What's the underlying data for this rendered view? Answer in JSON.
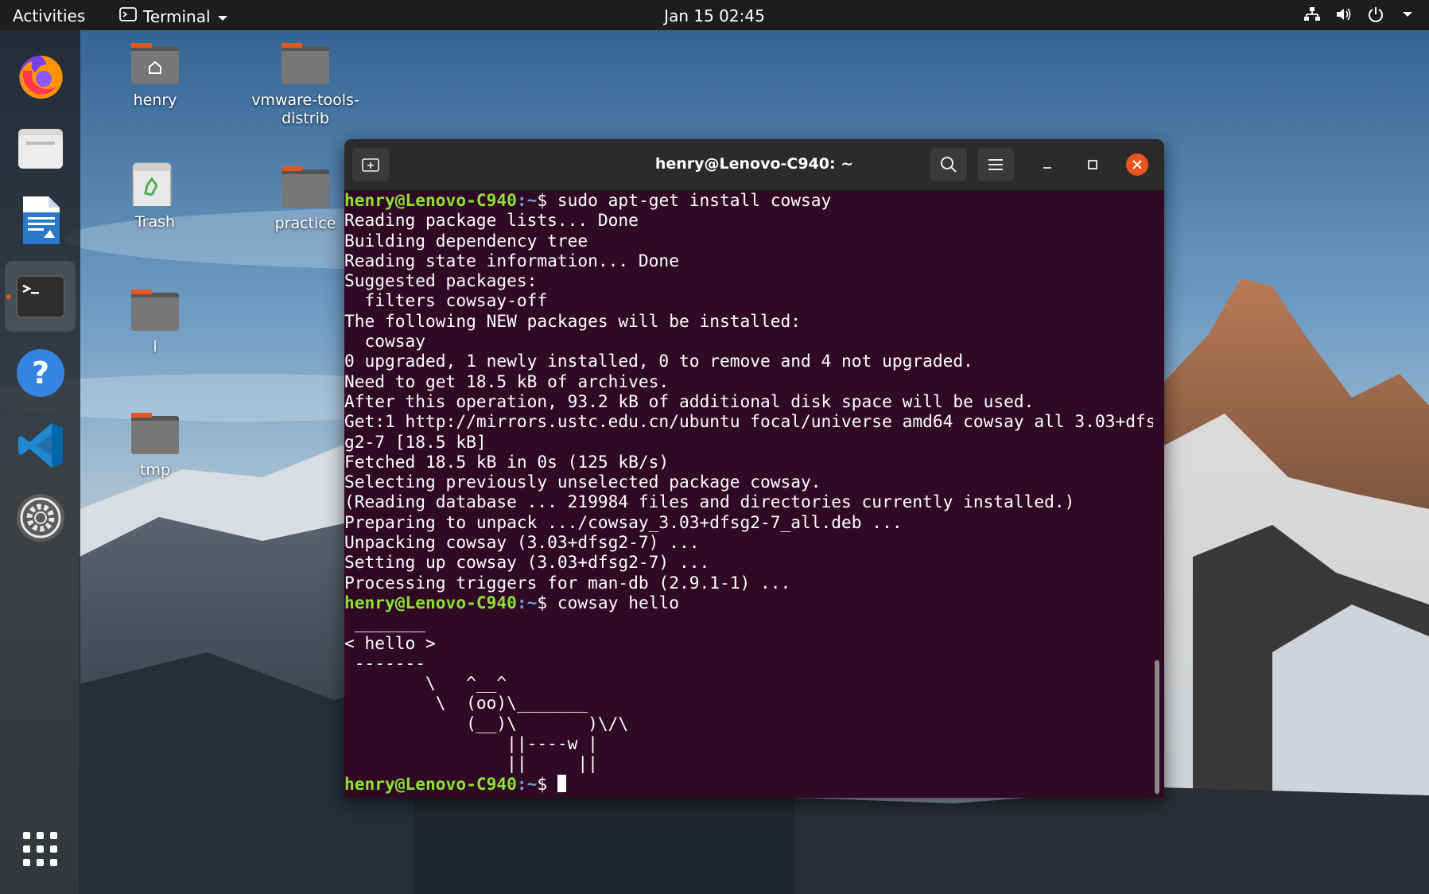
{
  "topbar": {
    "activities": "Activities",
    "app_name": "Terminal",
    "clock": "Jan 15  02:45"
  },
  "dock": {
    "items": [
      {
        "name": "Firefox"
      },
      {
        "name": "Files"
      },
      {
        "name": "LibreOffice Writer"
      },
      {
        "name": "Terminal"
      },
      {
        "name": "Help"
      },
      {
        "name": "Visual Studio Code"
      },
      {
        "name": "Settings"
      },
      {
        "name": "Show Applications"
      }
    ]
  },
  "desktop": {
    "icons": [
      {
        "label": "henry"
      },
      {
        "label": "vmware-tools-\ndistrib"
      },
      {
        "label": "Trash"
      },
      {
        "label": "practice"
      },
      {
        "label": "l"
      },
      {
        "label": "tmp"
      }
    ]
  },
  "terminal": {
    "title": "henry@Lenovo-C940: ~",
    "prompt_user": "henry@Lenovo-C940",
    "prompt_path": ":~",
    "prompt_symbol": "$",
    "lines": [
      {
        "type": "cmd",
        "text": " sudo apt-get install cowsay"
      },
      {
        "type": "out",
        "text": "Reading package lists... Done"
      },
      {
        "type": "out",
        "text": "Building dependency tree"
      },
      {
        "type": "out",
        "text": "Reading state information... Done"
      },
      {
        "type": "out",
        "text": "Suggested packages:"
      },
      {
        "type": "out",
        "text": "  filters cowsay-off"
      },
      {
        "type": "out",
        "text": "The following NEW packages will be installed:"
      },
      {
        "type": "out",
        "text": "  cowsay"
      },
      {
        "type": "out",
        "text": "0 upgraded, 1 newly installed, 0 to remove and 4 not upgraded."
      },
      {
        "type": "out",
        "text": "Need to get 18.5 kB of archives."
      },
      {
        "type": "out",
        "text": "After this operation, 93.2 kB of additional disk space will be used."
      },
      {
        "type": "out",
        "text": "Get:1 http://mirrors.ustc.edu.cn/ubuntu focal/universe amd64 cowsay all 3.03+dfs"
      },
      {
        "type": "out",
        "text": "g2-7 [18.5 kB]"
      },
      {
        "type": "out",
        "text": "Fetched 18.5 kB in 0s (125 kB/s)"
      },
      {
        "type": "out",
        "text": "Selecting previously unselected package cowsay."
      },
      {
        "type": "out",
        "text": "(Reading database ... 219984 files and directories currently installed.)"
      },
      {
        "type": "out",
        "text": "Preparing to unpack .../cowsay_3.03+dfsg2-7_all.deb ..."
      },
      {
        "type": "out",
        "text": "Unpacking cowsay (3.03+dfsg2-7) ..."
      },
      {
        "type": "out",
        "text": "Setting up cowsay (3.03+dfsg2-7) ..."
      },
      {
        "type": "out",
        "text": "Processing triggers for man-db (2.9.1-1) ..."
      },
      {
        "type": "cmd",
        "text": " cowsay hello"
      },
      {
        "type": "out",
        "text": " _______"
      },
      {
        "type": "out",
        "text": "< hello >"
      },
      {
        "type": "out",
        "text": " -------"
      },
      {
        "type": "out",
        "text": "        \\   ^__^"
      },
      {
        "type": "out",
        "text": "         \\  (oo)\\_______"
      },
      {
        "type": "out",
        "text": "            (__)\\       )\\/\\"
      },
      {
        "type": "out",
        "text": "                ||----w |"
      },
      {
        "type": "out",
        "text": "                ||     ||"
      },
      {
        "type": "prompt",
        "text": " "
      }
    ]
  },
  "colors": {
    "terminal_bg": "#300a24",
    "prompt_user": "#8ae234",
    "prompt_path": "#729fcf",
    "accent": "#e95420"
  }
}
